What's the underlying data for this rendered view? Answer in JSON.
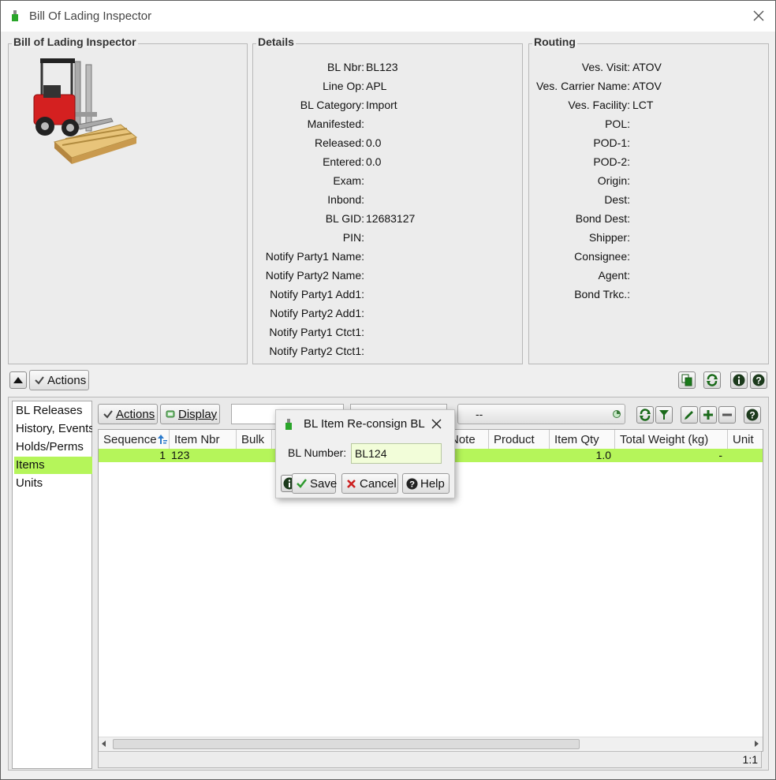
{
  "window": {
    "title": "Bill Of Lading Inspector"
  },
  "inspector_panel": {
    "legend": "Bill of Lading Inspector"
  },
  "details": {
    "legend": "Details",
    "fields": [
      {
        "label": "BL Nbr:",
        "value": "BL123"
      },
      {
        "label": "Line Op:",
        "value": "APL"
      },
      {
        "label": "BL Category:",
        "value": "Import"
      },
      {
        "label": "Manifested:",
        "value": ""
      },
      {
        "label": "Released:",
        "value": "0.0"
      },
      {
        "label": "Entered:",
        "value": "0.0"
      },
      {
        "label": "Exam:",
        "value": ""
      },
      {
        "label": "Inbond:",
        "value": ""
      },
      {
        "label": "BL GID:",
        "value": "12683127"
      },
      {
        "label": "PIN:",
        "value": ""
      },
      {
        "label": "Notify Party1 Name:",
        "value": ""
      },
      {
        "label": "Notify Party2 Name:",
        "value": ""
      },
      {
        "label": "Notify Party1 Add1:",
        "value": ""
      },
      {
        "label": "Notify Party2 Add1:",
        "value": ""
      },
      {
        "label": "Notify Party1 Ctct1:",
        "value": ""
      },
      {
        "label": "Notify Party2 Ctct1:",
        "value": ""
      }
    ]
  },
  "routing": {
    "legend": "Routing",
    "fields": [
      {
        "label": "Ves. Visit:",
        "value": "ATOV"
      },
      {
        "label": "Ves. Carrier Name:",
        "value": "ATOV"
      },
      {
        "label": "Ves. Facility:",
        "value": "LCT"
      },
      {
        "label": "POL:",
        "value": ""
      },
      {
        "label": "POD-1:",
        "value": ""
      },
      {
        "label": "POD-2:",
        "value": ""
      },
      {
        "label": "Origin:",
        "value": ""
      },
      {
        "label": "Dest:",
        "value": ""
      },
      {
        "label": "Bond Dest:",
        "value": ""
      },
      {
        "label": "Shipper:",
        "value": ""
      },
      {
        "label": "Consignee:",
        "value": ""
      },
      {
        "label": "Agent:",
        "value": ""
      },
      {
        "label": "Bond Trkc.:",
        "value": ""
      }
    ]
  },
  "toolbar": {
    "actions_label": "Actions"
  },
  "sidebar": {
    "items": [
      {
        "label": "BL Releases"
      },
      {
        "label": "History, Events"
      },
      {
        "label": "Holds/Perms"
      },
      {
        "label": "Items",
        "selected": true
      },
      {
        "label": "Units"
      }
    ]
  },
  "grid_toolbar": {
    "actions_label": "Actions",
    "display_label": "Display",
    "filter_value": "--"
  },
  "table": {
    "columns": [
      "Sequence",
      "Item Nbr",
      "Bulk",
      "Note",
      "Product",
      "Item Qty",
      "Total Weight (kg)",
      "Unit"
    ],
    "rows": [
      {
        "sequence": "1",
        "item_nbr": "123",
        "item_qty": "1.0",
        "total_weight": "-"
      }
    ],
    "row_count": "1:1"
  },
  "dialog": {
    "title": "BL Item Re-consign BL",
    "field_label": "BL Number:",
    "field_value": "BL124",
    "save_label": "Save",
    "cancel_label": "Cancel",
    "help_label": "Help"
  },
  "colors": {
    "selection": "#b5f55a",
    "save_icon": "#2e9a2e",
    "cancel_icon": "#cc1f1f",
    "help_icon": "#222222",
    "dialog_field_bg": "#f2fdd9"
  }
}
